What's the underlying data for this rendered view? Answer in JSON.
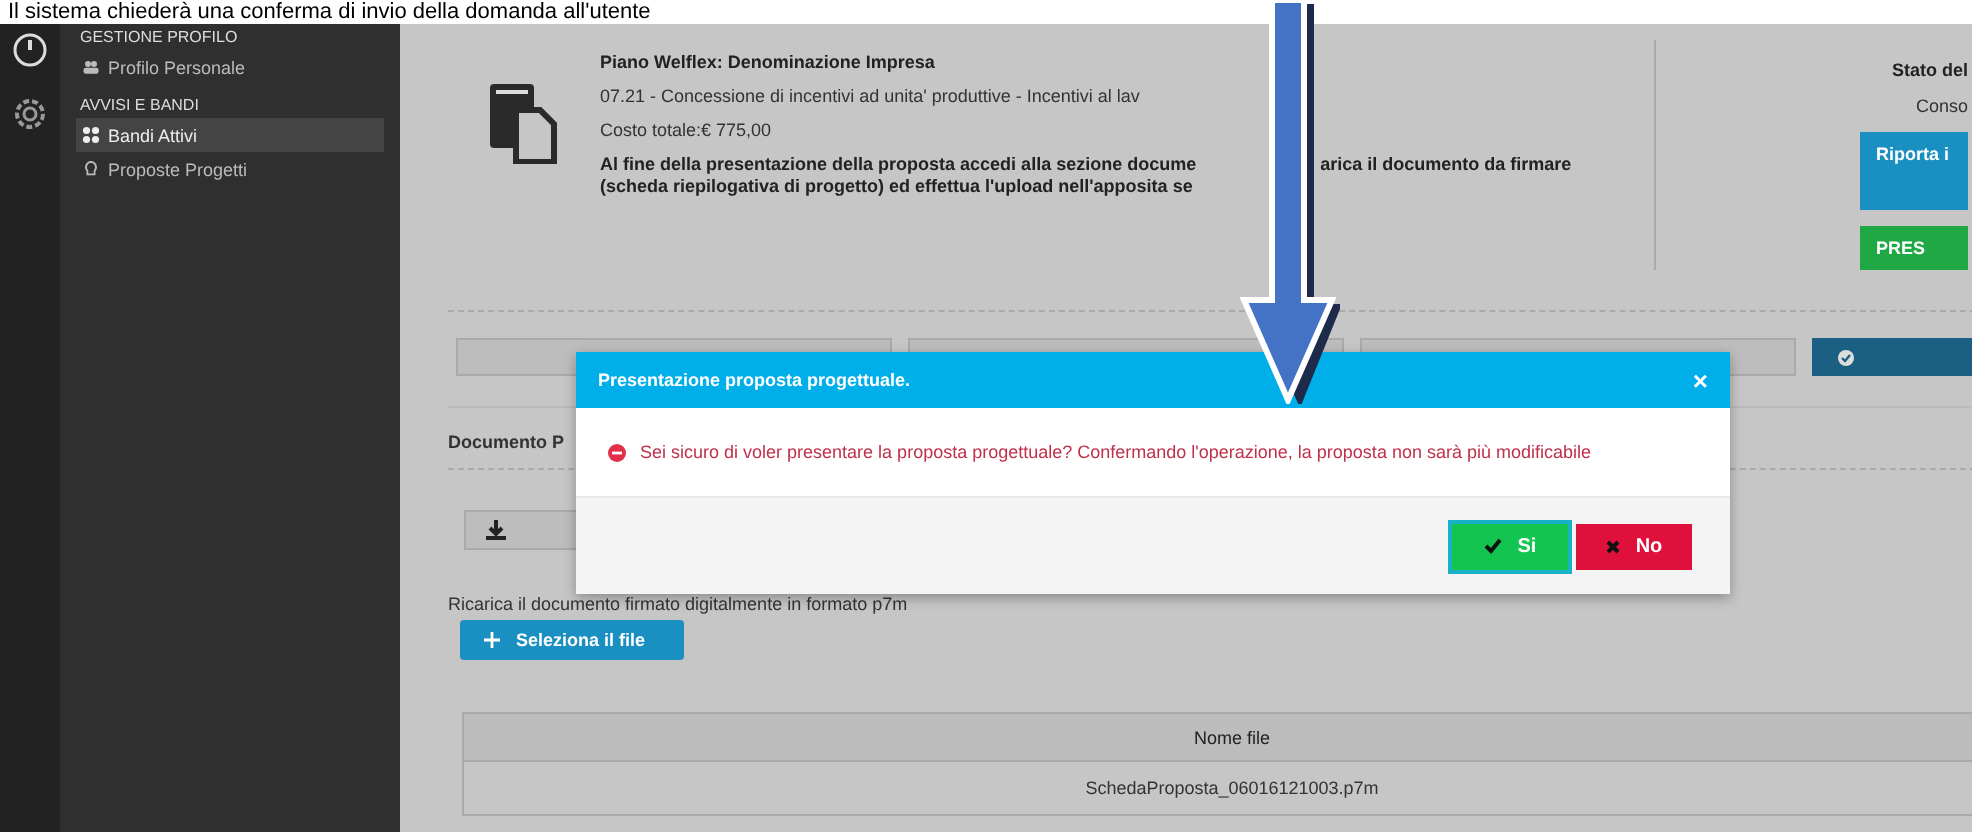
{
  "caption": "Il sistema chiederà una conferma di invio della domanda all'utente",
  "sidebar": {
    "sections": [
      {
        "title": "GESTIONE PROFILO",
        "items": [
          {
            "label": "Profilo Personale",
            "kind": "user",
            "selected": false
          }
        ]
      },
      {
        "title": "AVVISI E BANDI",
        "items": [
          {
            "label": "Bandi Attivi",
            "kind": "grid",
            "selected": true
          },
          {
            "label": "Proposte Progetti",
            "kind": "bulb",
            "selected": false
          }
        ]
      }
    ]
  },
  "proposal": {
    "title": "Piano Welflex: Denominazione Impresa",
    "line": "07.21 - Concessione di incentivi ad unita' produttive - Incentivi al lav",
    "cost": "Costo totale:€ 775,00",
    "note_parts": [
      "Al fine della presentazione della proposta accedi alla sezione docume",
      "arica il documento da firmare"
    ],
    "note_line2": "(scheda riepilogativa di progetto) ed effettua l'upload nell'apposita se"
  },
  "status": {
    "label": "Stato del",
    "value": "Conso",
    "buttons": [
      {
        "label": "Riporta i",
        "kind": "info"
      },
      {
        "label": "PRES",
        "kind": "success"
      }
    ]
  },
  "documents": {
    "title": "Documento P",
    "upload_hint": "Ricarica il documento firmato digitalmente in formato p7m",
    "select_button": "Seleziona il file",
    "table": {
      "columns": [
        "Nome file"
      ],
      "rows": [
        [
          "SchedaProposta_06016121003.p7m"
        ]
      ]
    }
  },
  "modal": {
    "title": "Presentazione proposta progettuale.",
    "close": "×",
    "message": "Sei sicuro di voler presentare la proposta progettuale? Confermando l'operazione, la proposta non sarà più modificabile",
    "buttons": [
      {
        "label": "Si",
        "kind": "confirm",
        "focused": true
      },
      {
        "label": "No",
        "kind": "cancel",
        "focused": false
      }
    ]
  }
}
